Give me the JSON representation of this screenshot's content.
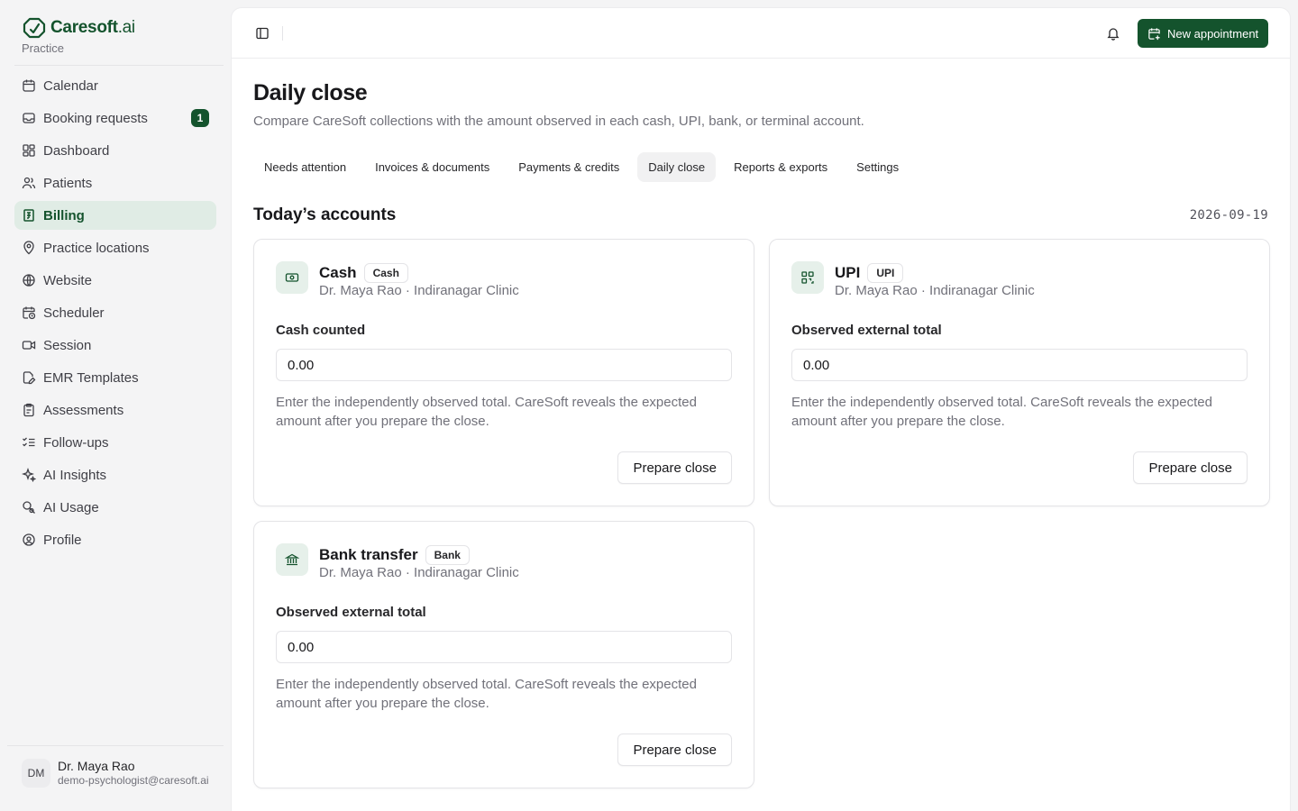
{
  "brand": {
    "name": "Caresoft",
    "suffix": ".ai",
    "subtitle": "Practice",
    "color": "#14532d"
  },
  "sidebar": {
    "items": [
      {
        "label": "Calendar",
        "icon": "calendar-icon"
      },
      {
        "label": "Booking requests",
        "icon": "inbox-icon",
        "badge": "1"
      },
      {
        "label": "Dashboard",
        "icon": "dashboard-icon"
      },
      {
        "label": "Patients",
        "icon": "users-icon"
      },
      {
        "label": "Billing",
        "icon": "receipt-icon",
        "active": true
      },
      {
        "label": "Practice locations",
        "icon": "map-pin-icon"
      },
      {
        "label": "Website",
        "icon": "globe-icon"
      },
      {
        "label": "Scheduler",
        "icon": "calendar-clock-icon"
      },
      {
        "label": "Session",
        "icon": "video-icon"
      },
      {
        "label": "EMR Templates",
        "icon": "file-edit-icon"
      },
      {
        "label": "Assessments",
        "icon": "clipboard-icon"
      },
      {
        "label": "Follow-ups",
        "icon": "list-check-icon"
      },
      {
        "label": "AI Insights",
        "icon": "sparkles-icon"
      },
      {
        "label": "AI Usage",
        "icon": "search-coins-icon"
      },
      {
        "label": "Profile",
        "icon": "user-circle-icon"
      }
    ],
    "user": {
      "initials": "DM",
      "name": "Dr. Maya Rao",
      "email": "demo-psychologist@caresoft.ai"
    }
  },
  "header": {
    "new_appointment_label": "New appointment"
  },
  "page": {
    "title": "Daily close",
    "subtitle": "Compare CareSoft collections with the amount observed in each cash, UPI, bank, or terminal account.",
    "tabs": [
      {
        "label": "Needs attention"
      },
      {
        "label": "Invoices & documents"
      },
      {
        "label": "Payments & credits"
      },
      {
        "label": "Daily close",
        "active": true
      },
      {
        "label": "Reports & exports"
      },
      {
        "label": "Settings"
      }
    ],
    "section_title": "Today’s accounts",
    "section_date": "2026-09-19"
  },
  "cards": [
    {
      "name": "Cash",
      "tag": "Cash",
      "icon": "banknote-icon",
      "meta": "Dr. Maya Rao · Indiranagar Clinic",
      "field_label": "Cash counted",
      "value": "0.00",
      "help": "Enter the independently observed total. CareSoft reveals the expected amount after you prepare the close.",
      "button": "Prepare close"
    },
    {
      "name": "UPI",
      "tag": "UPI",
      "icon": "qr-code-icon",
      "meta": "Dr. Maya Rao · Indiranagar Clinic",
      "field_label": "Observed external total",
      "value": "0.00",
      "help": "Enter the independently observed total. CareSoft reveals the expected amount after you prepare the close.",
      "button": "Prepare close"
    },
    {
      "name": "Bank transfer",
      "tag": "Bank",
      "icon": "bank-icon",
      "meta": "Dr. Maya Rao · Indiranagar Clinic",
      "field_label": "Observed external total",
      "value": "0.00",
      "help": "Enter the independently observed total. CareSoft reveals the expected amount after you prepare the close.",
      "button": "Prepare close"
    }
  ]
}
